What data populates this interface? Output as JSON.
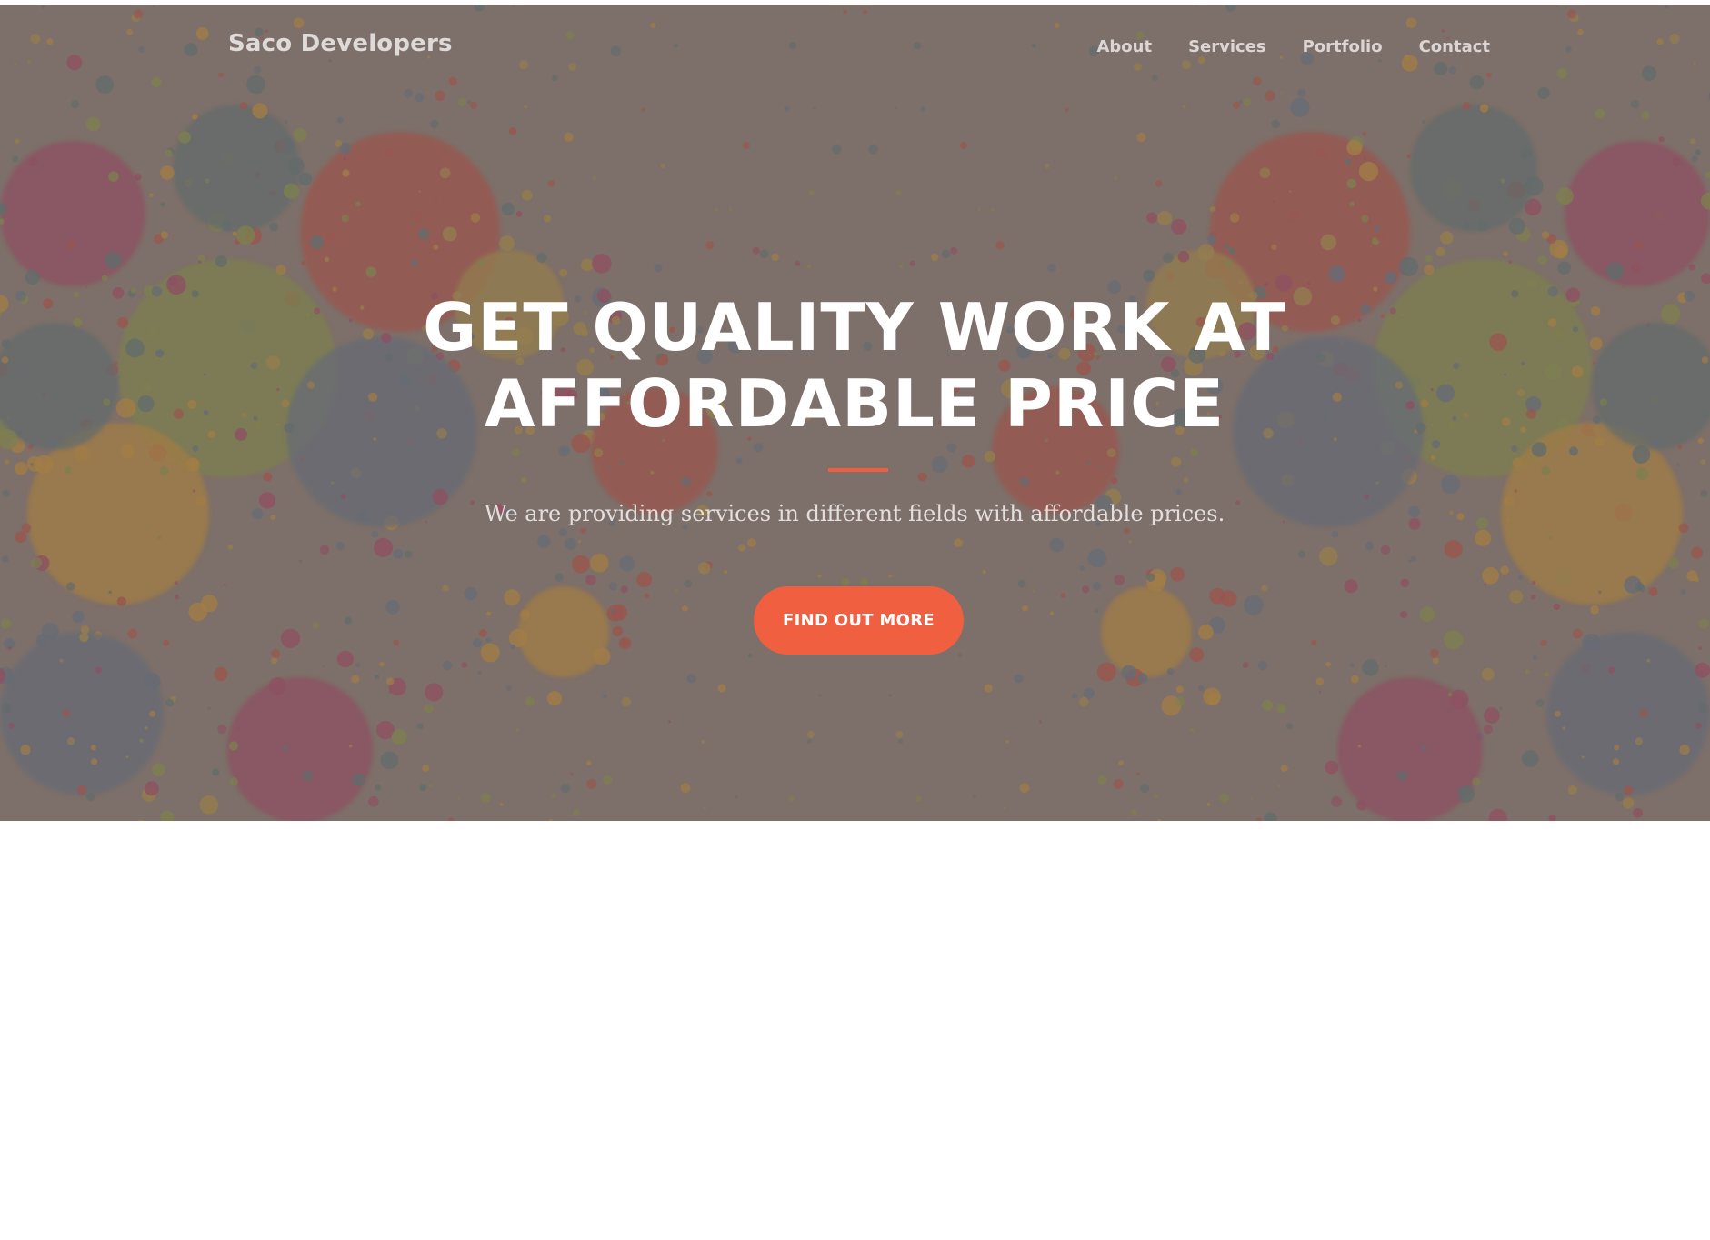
{
  "navbar": {
    "brand": "Saco Developers",
    "links": [
      "About",
      "Services",
      "Portfolio",
      "Contact"
    ]
  },
  "hero": {
    "headline_line1": "GET QUALITY WORK AT",
    "headline_line2": "AFFORDABLE PRICE",
    "subtitle": "We are providing services in different fields with affordable prices.",
    "cta_label": "FIND OUT MORE"
  },
  "colors": {
    "accent": "#f05f40",
    "hero_bg": "#7f716a",
    "page_bg": "#ffffff",
    "splatter_palette": [
      "#9b3b5e",
      "#4f6b6f",
      "#7e8e3c",
      "#c08a2c",
      "#b0443a",
      "#566a80",
      "#a88a3a"
    ]
  }
}
